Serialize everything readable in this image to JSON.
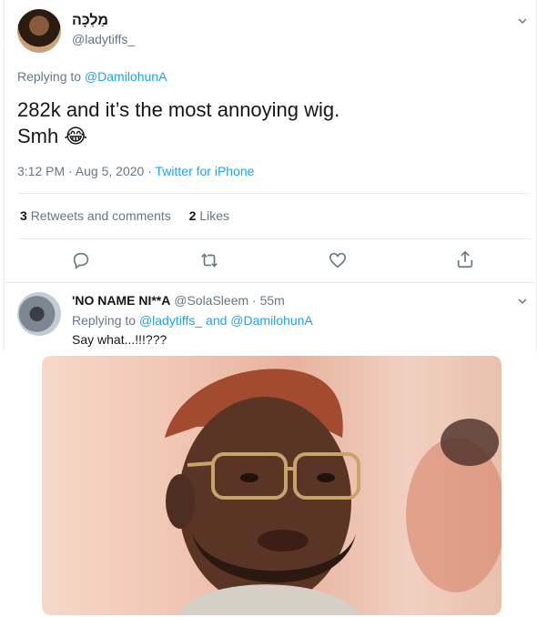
{
  "tweet": {
    "display_name": "מַלְכָּה",
    "handle": "@ladytiffs_",
    "replying_prefix": "Replying to",
    "replying_to": "@DamilohunA",
    "text_line1": "282k and it’s the most annoying wig.",
    "text_line2": "Smh",
    "emoji": "😂",
    "timestamp": "3:12 PM · Aug 5, 2020 · ",
    "source": "Twitter for iPhone",
    "retweets_count": "3",
    "retweets_label": "Retweets and comments",
    "likes_count": "2",
    "likes_label": "Likes"
  },
  "reply": {
    "display_name": "'NO NAME NI**A",
    "handle": "@SolaSleem",
    "time": " · 55m",
    "replying_prefix": "Replying to",
    "replying_to_1": "@ladytiffs_",
    "and_text": "and",
    "replying_to_2": "@DamilohunA",
    "text": "Say what...!!!???"
  },
  "colors": {
    "accent": "#1da1f2",
    "muted": "#657786",
    "border": "#e6ecf0"
  },
  "icons": [
    "chevron-down-icon",
    "reply-icon",
    "retweet-icon",
    "like-icon",
    "share-icon"
  ]
}
